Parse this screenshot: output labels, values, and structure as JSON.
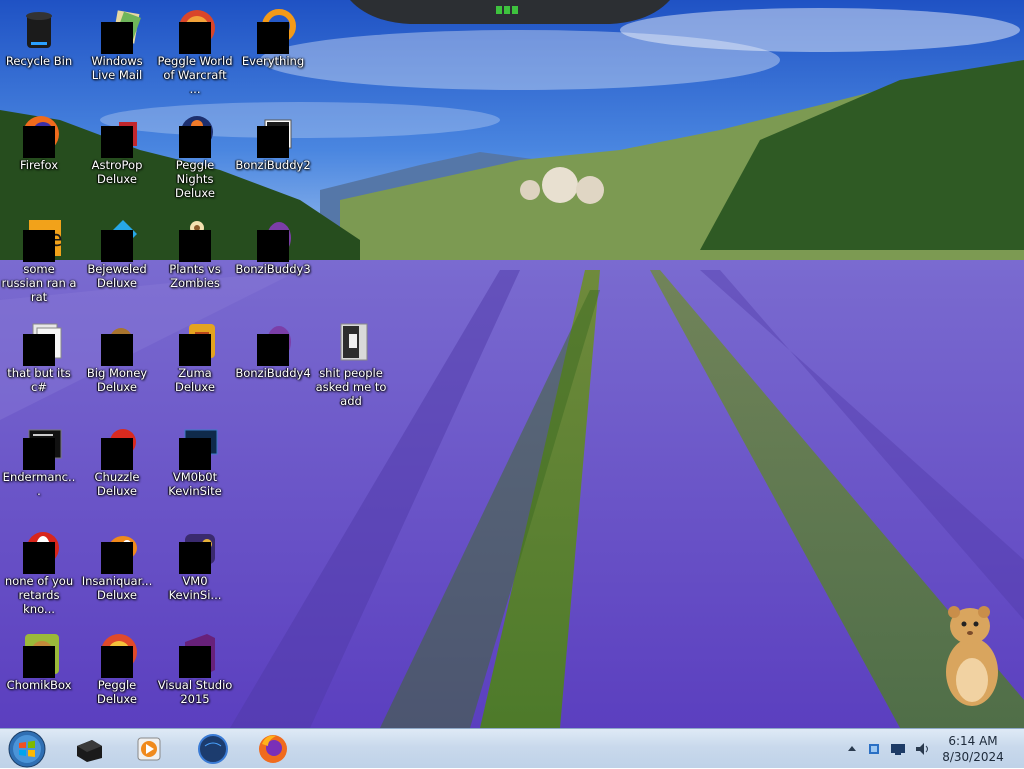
{
  "desktop": {
    "icons": [
      {
        "label": "Recycle Bin",
        "icon": "recycle-bin-icon"
      },
      {
        "label": "Windows Live Mail",
        "icon": "windows-live-mail-icon"
      },
      {
        "label": "Peggle World of Warcraft ...",
        "icon": "peggle-wow-icon"
      },
      {
        "label": "Everything",
        "icon": "everything-search-icon"
      },
      {
        "label": "Firefox",
        "icon": "firefox-icon"
      },
      {
        "label": "AstroPop Deluxe",
        "icon": "astropop-icon"
      },
      {
        "label": "Peggle Nights Deluxe",
        "icon": "peggle-nights-icon"
      },
      {
        "label": "BonziBuddy2",
        "icon": "bonzibuddy-icon"
      },
      {
        "label": "some russian ran a rat",
        "icon": "file-icon"
      },
      {
        "label": "Bejeweled Deluxe",
        "icon": "bejeweled-icon"
      },
      {
        "label": "Plants vs Zombies",
        "icon": "plants-vs-zombies-icon"
      },
      {
        "label": "BonziBuddy3",
        "icon": "bonzibuddy-icon"
      },
      {
        "label": "that but its c#",
        "icon": "file-icon"
      },
      {
        "label": "Big Money Deluxe",
        "icon": "big-money-icon"
      },
      {
        "label": "Zuma Deluxe",
        "icon": "zuma-icon"
      },
      {
        "label": "BonziBuddy4",
        "icon": "bonzibuddy-icon"
      },
      {
        "label": "shit people asked me to add",
        "icon": "folder-icon"
      },
      {
        "label": "Endermanc...",
        "icon": "terminal-icon"
      },
      {
        "label": "Chuzzle Deluxe",
        "icon": "chuzzle-icon"
      },
      {
        "label": "VM0b0t KevinSite",
        "icon": "vm-icon"
      },
      {
        "label": "none of you retards kno...",
        "icon": "opera-like-icon"
      },
      {
        "label": "Insaniquar... Deluxe",
        "icon": "insaniquarium-icon"
      },
      {
        "label": "VM0 KevinSi...",
        "icon": "vm-icon"
      },
      {
        "label": "ChomikBox",
        "icon": "chomikbox-icon"
      },
      {
        "label": "Peggle Deluxe",
        "icon": "peggle-icon"
      },
      {
        "label": "Visual Studio 2015",
        "icon": "visual-studio-icon"
      }
    ]
  },
  "taskbar": {
    "start": {
      "icon": "windows-start-orb-icon"
    },
    "pinned": [
      {
        "name": "taskbar-pinned-terminal",
        "icon": "terminal-box-icon"
      },
      {
        "name": "taskbar-pinned-media-player",
        "icon": "media-player-icon"
      },
      {
        "name": "taskbar-pinned-globe",
        "icon": "globe-icon"
      },
      {
        "name": "taskbar-pinned-firefox",
        "icon": "firefox-icon"
      }
    ],
    "tray": {
      "icons": [
        "show-hidden-icons-arrow-icon",
        "action-center-flag-icon",
        "network-monitor-icon",
        "speaker-icon"
      ],
      "time": "6:14 AM",
      "date": "8/30/2024"
    }
  },
  "colors": {
    "taskbar": "#c9d9ec",
    "label_text": "#ffffff",
    "lavender": "#6a52c8"
  }
}
